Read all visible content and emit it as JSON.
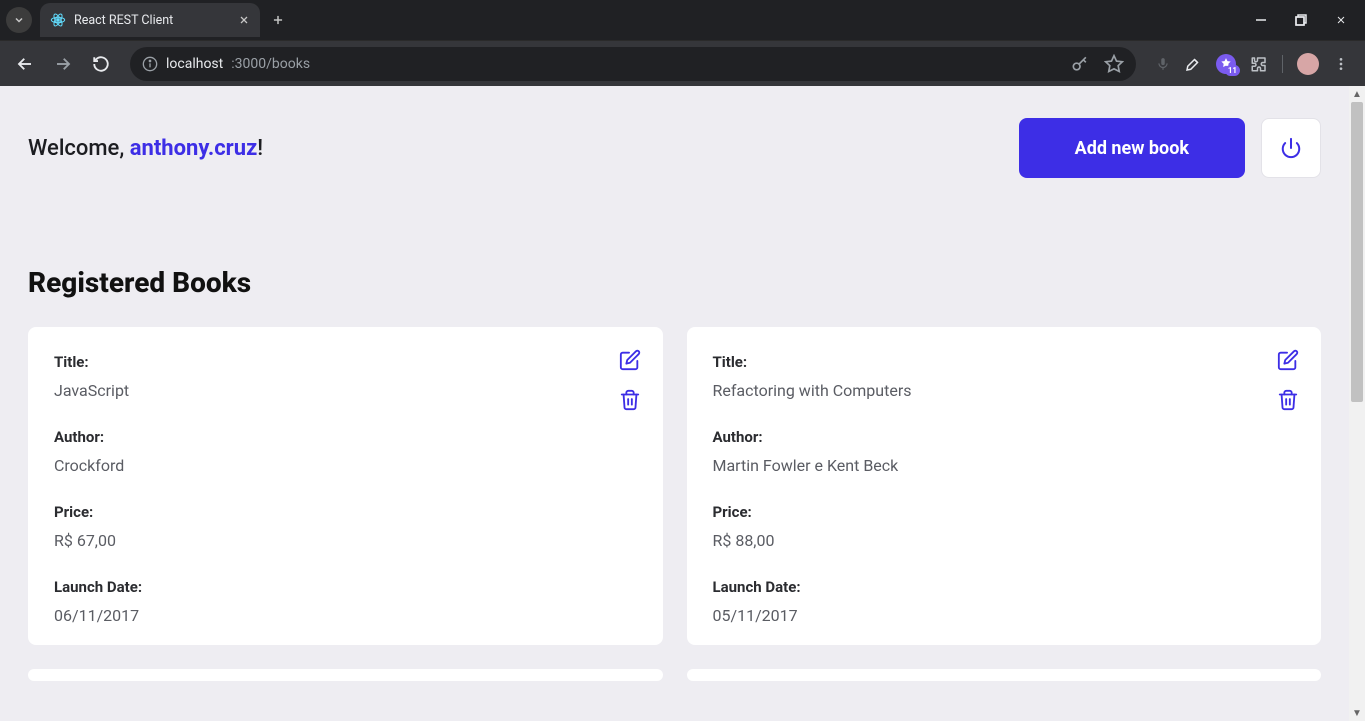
{
  "browser": {
    "tab_title": "React REST Client",
    "url_host": "localhost",
    "url_port_path": ":3000/books",
    "ext_badge": "11"
  },
  "header": {
    "welcome_prefix": "Welcome, ",
    "username": "anthony.cruz",
    "welcome_suffix": "!",
    "add_button": "Add new book"
  },
  "section_title": "Registered Books",
  "labels": {
    "title": "Title:",
    "author": "Author:",
    "price": "Price:",
    "launch_date": "Launch Date:"
  },
  "books": [
    {
      "title": "JavaScript",
      "author": "Crockford",
      "price": "R$ 67,00",
      "launch_date": "06/11/2017"
    },
    {
      "title": "Refactoring with Computers",
      "author": "Martin Fowler e Kent Beck",
      "price": "R$ 88,00",
      "launch_date": "05/11/2017"
    }
  ]
}
